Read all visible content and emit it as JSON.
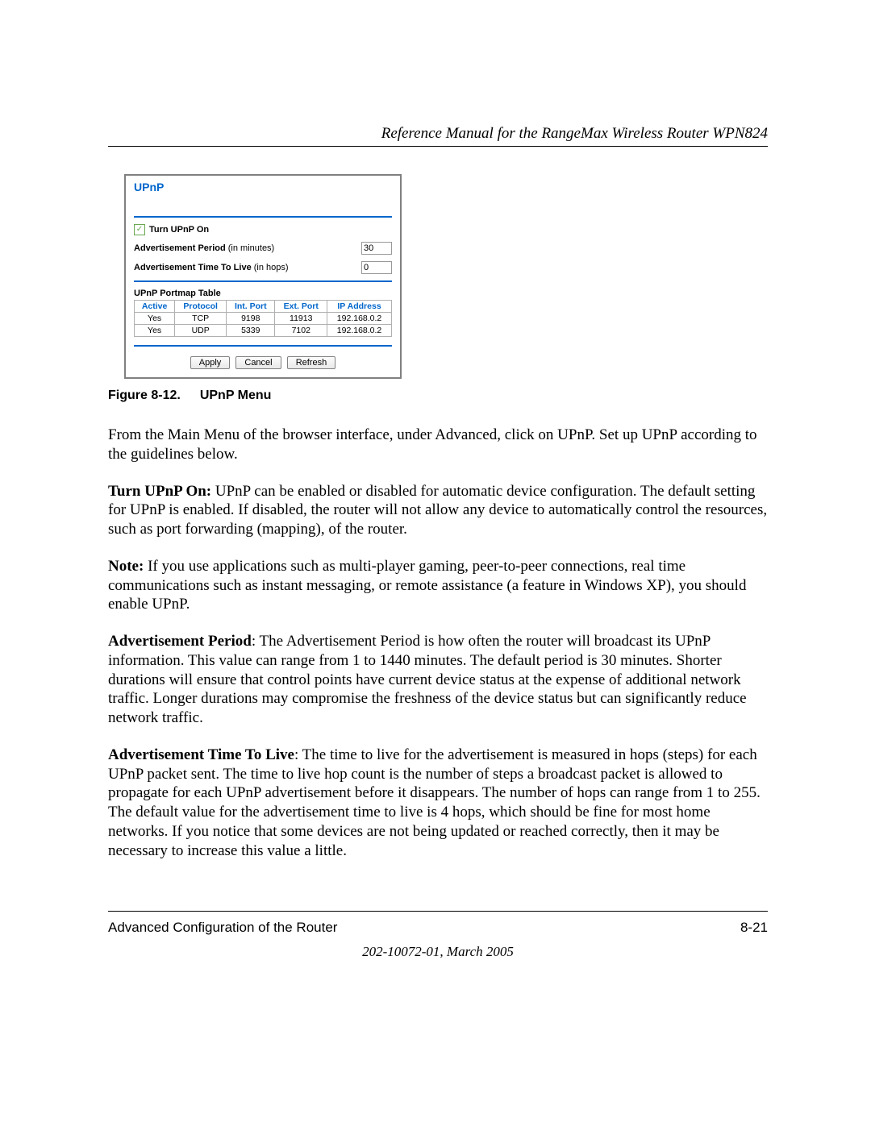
{
  "header": {
    "title": "Reference Manual for the RangeMax Wireless Router WPN824"
  },
  "screenshot": {
    "title": "UPnP",
    "checkbox_label": "Turn UPnP On",
    "adv_period_label": "Advertisement Period",
    "adv_period_unit": " (in minutes)",
    "adv_period_value": "30",
    "adv_ttl_label": "Advertisement Time To Live",
    "adv_ttl_unit": " (in hops)",
    "adv_ttl_value": "0",
    "portmap_heading": "UPnP Portmap Table",
    "headers": {
      "active": "Active",
      "protocol": "Protocol",
      "int_port": "Int. Port",
      "ext_port": "Ext. Port",
      "ip": "IP Address"
    },
    "rows": [
      {
        "active": "Yes",
        "protocol": "TCP",
        "int_port": "9198",
        "ext_port": "11913",
        "ip": "192.168.0.2"
      },
      {
        "active": "Yes",
        "protocol": "UDP",
        "int_port": "5339",
        "ext_port": "7102",
        "ip": "192.168.0.2"
      }
    ],
    "buttons": {
      "apply": "Apply",
      "cancel": "Cancel",
      "refresh": "Refresh"
    }
  },
  "figure_caption": {
    "prefix": "Figure 8-12.",
    "title": "UPnP Menu"
  },
  "paragraphs": {
    "p1": "From the Main Menu of the browser interface, under Advanced, click on UPnP. Set up UPnP according to the guidelines below.",
    "p2_lead": "Turn UPnP On: ",
    "p2_body": "UPnP can be enabled or disabled for automatic device configuration. The default setting for UPnP is enabled. If disabled, the router will not allow any device to automatically control the resources, such as port forwarding (mapping), of the router.",
    "p3_lead": "Note: ",
    "p3_body": "If you use applications such as multi-player gaming, peer-to-peer connections, real time communications such as instant messaging, or remote assistance (a feature in Windows XP), you should enable UPnP.",
    "p4_lead": "Advertisement Period",
    "p4_body": ": The Advertisement Period is how often the router will broadcast its UPnP information. This value can range from 1 to 1440 minutes. The default period is 30 minutes. Shorter durations will ensure that control points have current device status at the expense of additional network traffic. Longer durations may compromise the freshness of the device status but can significantly reduce network traffic.",
    "p5_lead": "Advertisement Time To Live",
    "p5_body": ": The time to live for the advertisement is measured in hops (steps) for each UPnP packet sent. The time to live hop count is the number of steps a broadcast packet is allowed to propagate for each UPnP advertisement before it disappears. The number of hops can range from 1 to 255. The default value for the advertisement time to live is 4 hops, which should be fine for most home networks. If you notice that some devices are not being updated or reached correctly, then it may be necessary to increase this value a little."
  },
  "footer": {
    "section": "Advanced Configuration of the Router",
    "page": "8-21",
    "docid": "202-10072-01, March 2005"
  }
}
